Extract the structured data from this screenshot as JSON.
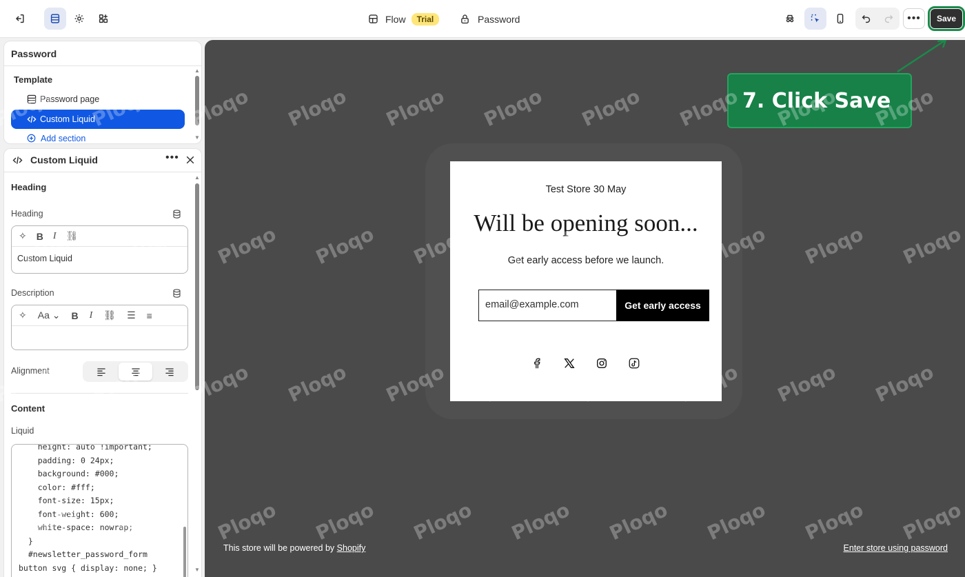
{
  "topbar": {
    "flow_label": "Flow",
    "trial_badge": "Trial",
    "password_label": "Password",
    "save_label": "Save",
    "more_label": "•••"
  },
  "sidebar": {
    "panel_title": "Password",
    "template_label": "Template",
    "items": [
      {
        "label": "Password page"
      },
      {
        "label": "Custom Liquid"
      }
    ],
    "add_section": "Add section"
  },
  "settings": {
    "title": "Custom Liquid",
    "heading_group": "Heading",
    "heading_label": "Heading",
    "heading_value": "Custom Liquid",
    "description_label": "Description",
    "description_value": "",
    "alignment_label": "Alignment",
    "content_group": "Content",
    "liquid_label": "Liquid",
    "code_lines": [
      "    height: auto !important;",
      "    padding: 0 24px;",
      "    background: #000;",
      "    color: #fff;",
      "    font-size: 15px;",
      "    font-weight: 600;",
      "    white-space: nowrap;",
      "  }",
      "  #newsletter_password_form",
      "button svg { display: none; }"
    ]
  },
  "preview": {
    "store_name": "Test Store 30 May",
    "headline": "Will be opening soon...",
    "subline": "Get early access before we launch.",
    "email_placeholder": "email@example.com",
    "cta_label": "Get early access",
    "social_icons": [
      "facebook-icon",
      "x-icon",
      "instagram-icon",
      "tiktok-icon"
    ],
    "footer_prefix": "This store will be powered by ",
    "footer_link": "Shopify",
    "enter_password": "Enter store using password"
  },
  "callout": {
    "text": "7. Click Save"
  },
  "watermark": {
    "text": "Ploqo"
  },
  "colors": {
    "accent_blue": "#1058e3",
    "callout_green": "#178148",
    "trial_yellow": "#ffe67a",
    "canvas_bg": "#4a4a4a"
  }
}
